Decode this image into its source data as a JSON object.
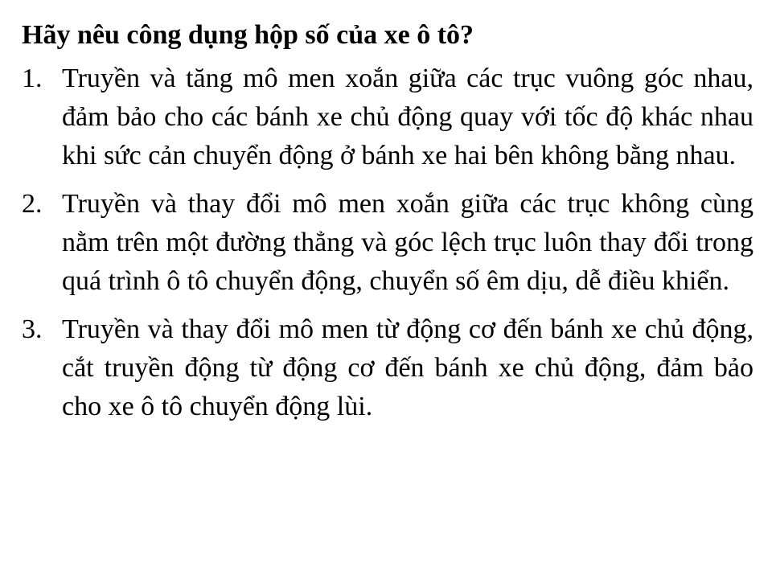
{
  "question": "Hãy nêu công dụng hộp số của xe ô tô?",
  "answers": [
    {
      "number": "1.",
      "text": "Truyền và tăng mô men xoắn giữa các trục vuông góc nhau, đảm bảo cho các bánh xe chủ động quay với tốc độ khác nhau khi sức cản chuyển động ở bánh xe hai bên không bằng nhau."
    },
    {
      "number": "2.",
      "text": "Truyền và thay đổi mô men xoắn giữa các trục không cùng nằm trên một đường thẳng và góc lệch trục luôn thay đổi trong quá trình ô tô chuyển động, chuyển số êm dịu, dễ điều khiển."
    },
    {
      "number": "3.",
      "text": "Truyền và thay đổi mô men từ động cơ đến bánh xe chủ động, cắt truyền động từ động cơ đến bánh xe chủ động, đảm bảo cho xe ô tô chuyển động lùi."
    }
  ]
}
